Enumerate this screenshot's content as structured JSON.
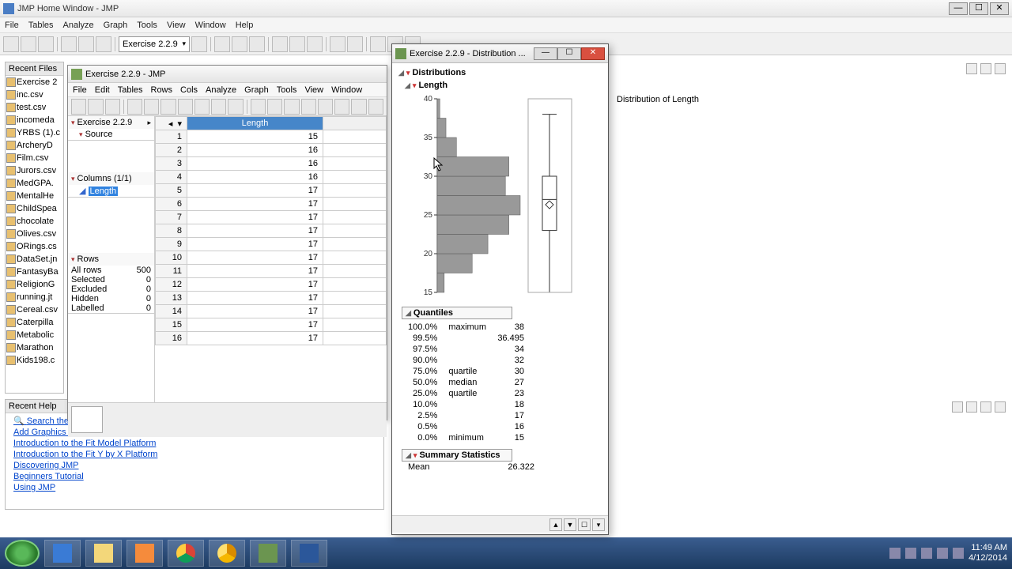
{
  "main_title": "JMP Home Window - JMP",
  "menubar": [
    "File",
    "Tables",
    "Analyze",
    "Graph",
    "Tools",
    "View",
    "Window",
    "Help"
  ],
  "combo_value": "Exercise 2.2.9",
  "recent_files": {
    "header": "Recent Files",
    "items": [
      "Exercise 2",
      "inc.csv",
      "test.csv",
      "incomeda",
      "YRBS (1).c",
      "ArcheryD",
      "Film.csv",
      "Jurors.csv",
      "MedGPA.",
      "MentalHe",
      "ChildSpea",
      "chocolate",
      "Olives.csv",
      "ORings.cs",
      "DataSet.jn",
      "FantasyBa",
      "ReligionG",
      "running.jt",
      "Cereal.csv",
      "Caterpilla",
      "Metabolic",
      "Marathon",
      "Kids198.c"
    ]
  },
  "recent_help": {
    "header": "Recent Help",
    "links": [
      "Search the",
      "Add Graphics Elements to a Report",
      "Introduction to the Fit Model Platform",
      "Introduction to the Fit Y by X Platform",
      "Discovering JMP",
      "Beginners Tutorial",
      "Using JMP"
    ]
  },
  "dtwin": {
    "title": "Exercise 2.2.9 - JMP",
    "menubar": [
      "File",
      "Edit",
      "Tables",
      "Rows",
      "Cols",
      "Analyze",
      "Graph",
      "Tools",
      "View",
      "Window"
    ],
    "panel_name": "Exercise 2.2.9",
    "source_label": "Source",
    "columns_label": "Columns (1/1)",
    "col1": "Length",
    "rows_label": "Rows",
    "rowstats": [
      [
        "All rows",
        "500"
      ],
      [
        "Selected",
        "0"
      ],
      [
        "Excluded",
        "0"
      ],
      [
        "Hidden",
        "0"
      ],
      [
        "Labelled",
        "0"
      ]
    ],
    "col_header": "Length",
    "rows": [
      [
        "1",
        "15"
      ],
      [
        "2",
        "16"
      ],
      [
        "3",
        "16"
      ],
      [
        "4",
        "16"
      ],
      [
        "5",
        "17"
      ],
      [
        "6",
        "17"
      ],
      [
        "7",
        "17"
      ],
      [
        "8",
        "17"
      ],
      [
        "9",
        "17"
      ],
      [
        "10",
        "17"
      ],
      [
        "11",
        "17"
      ],
      [
        "12",
        "17"
      ],
      [
        "13",
        "17"
      ],
      [
        "14",
        "17"
      ],
      [
        "15",
        "17"
      ],
      [
        "16",
        "17"
      ]
    ]
  },
  "distwin": {
    "title": "Exercise 2.2.9 - Distribution ...",
    "hdr1": "Distributions",
    "hdr2": "Length",
    "quant_hdr": "Quantiles",
    "quantiles": [
      [
        "100.0%",
        "maximum",
        "38"
      ],
      [
        "99.5%",
        "",
        "36.495"
      ],
      [
        "97.5%",
        "",
        "34"
      ],
      [
        "90.0%",
        "",
        "32"
      ],
      [
        "75.0%",
        "quartile",
        "30"
      ],
      [
        "50.0%",
        "median",
        "27"
      ],
      [
        "25.0%",
        "quartile",
        "23"
      ],
      [
        "10.0%",
        "",
        "18"
      ],
      [
        "2.5%",
        "",
        "17"
      ],
      [
        "0.5%",
        "",
        "16"
      ],
      [
        "0.0%",
        "minimum",
        "15"
      ]
    ],
    "sum_hdr": "Summary Statistics",
    "sum_row": [
      "Mean",
      "26.322"
    ]
  },
  "right_label": "Distribution of Length",
  "chart_data": {
    "type": "histogram",
    "title": "Length",
    "ylabel": "",
    "ylim": [
      15,
      40
    ],
    "yticks": [
      15,
      20,
      25,
      30,
      35,
      40
    ],
    "bins": [
      {
        "low": 15,
        "high": 17.5,
        "count_est": 8
      },
      {
        "low": 17.5,
        "high": 20,
        "count_est": 40
      },
      {
        "low": 20,
        "high": 22.5,
        "count_est": 58
      },
      {
        "low": 22.5,
        "high": 25,
        "count_est": 82
      },
      {
        "low": 25,
        "high": 27.5,
        "count_est": 95
      },
      {
        "low": 27.5,
        "high": 30,
        "count_est": 78
      },
      {
        "low": 30,
        "high": 32.5,
        "count_est": 82
      },
      {
        "low": 32.5,
        "high": 35,
        "count_est": 22
      },
      {
        "low": 35,
        "high": 37.5,
        "count_est": 10
      },
      {
        "low": 37.5,
        "high": 40,
        "count_est": 3
      }
    ],
    "boxplot": {
      "min": 15,
      "q1": 23,
      "median": 27,
      "q3": 30,
      "max": 38,
      "mean": 26.322
    }
  },
  "taskbar": {
    "clock_time": "11:49 AM",
    "clock_date": "4/12/2014"
  }
}
